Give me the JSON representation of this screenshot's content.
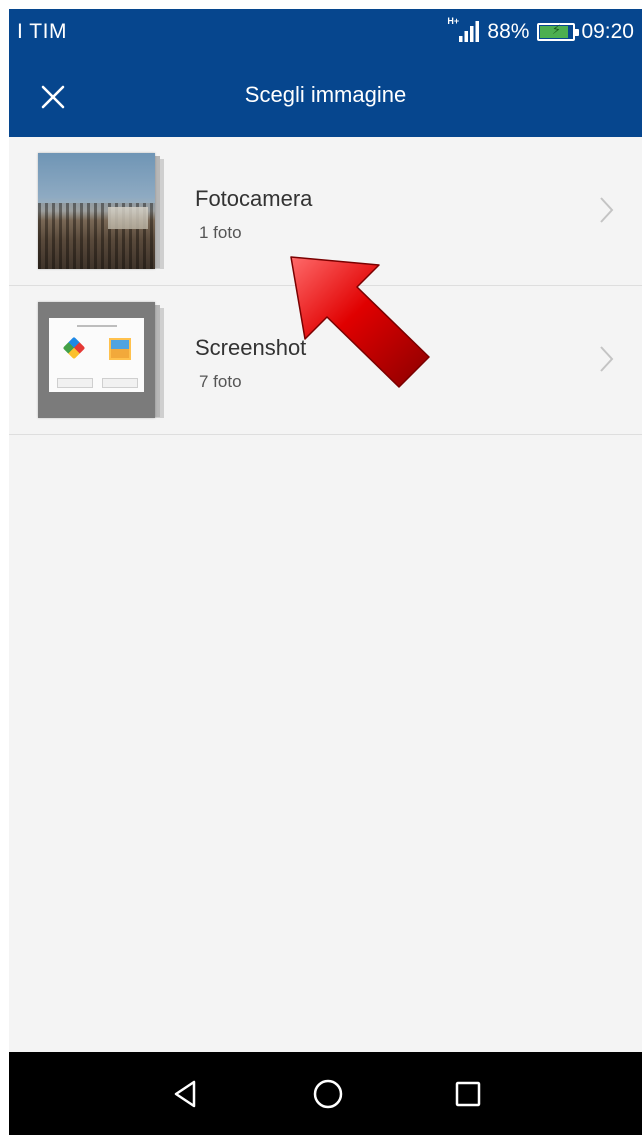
{
  "status_bar": {
    "carrier": "I TIM",
    "network_type": "H+",
    "battery_percent": "88%",
    "battery_level": 0.88,
    "time": "09:20"
  },
  "app_bar": {
    "title": "Scegli immagine",
    "close_icon": "close-icon"
  },
  "albums": [
    {
      "name": "Fotocamera",
      "count": "1 foto",
      "thumbnail": "landscape-photo",
      "chevron_icon": "chevron-right-icon"
    },
    {
      "name": "Screenshot",
      "count": "7 foto",
      "thumbnail": "screenshot-preview",
      "chevron_icon": "chevron-right-icon"
    }
  ],
  "annotation": {
    "type": "red-arrow",
    "color": "#d50000",
    "points_to": "Fotocamera"
  },
  "nav_bar": {
    "back_icon": "back-triangle-icon",
    "home_icon": "home-circle-icon",
    "recent_icon": "recent-apps-square-icon"
  },
  "colors": {
    "primary": "#06468e",
    "background": "#f4f4f4",
    "divider": "#dedede",
    "nav_bar": "#000000",
    "battery_green": "#4caf50"
  }
}
